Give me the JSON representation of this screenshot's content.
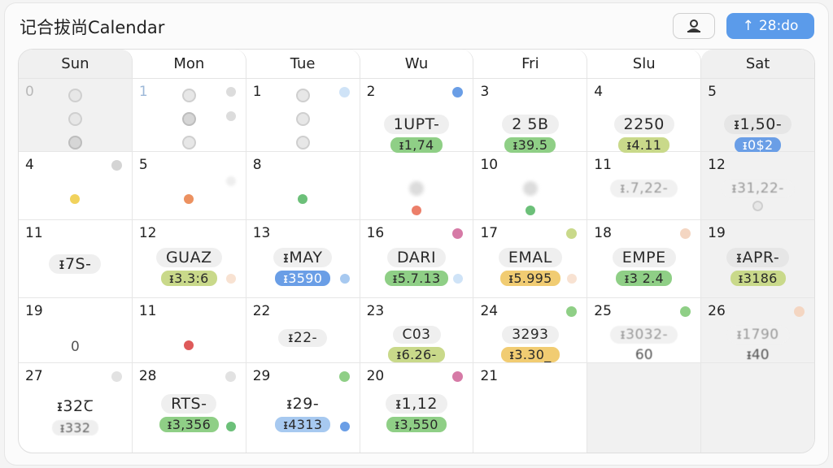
{
  "app": {
    "title": "记合拔尚Calendar"
  },
  "toolbar": {
    "profile_icon": "profile-icon",
    "primary_label": "28:do",
    "primary_icon": "arrow-up-icon"
  },
  "weekdays": [
    "Sun",
    "Mon",
    "Tue",
    "Wu",
    "Fri",
    "Slu",
    "Sat"
  ],
  "colors": {
    "green": "#8fcf86",
    "olive": "#c9d98a",
    "blue": "#6a9ee6",
    "light_blue": "#a7c9f0",
    "yellow": "#f1cc72",
    "red": "#de6a6a",
    "orange": "#ec9160",
    "pink": "#d67aa6",
    "gray": "#cfcfcf",
    "peach": "#f4d6c2"
  },
  "week0": {
    "sun": {
      "day": "0"
    },
    "mon": {
      "day": "1"
    },
    "tue": {
      "day": "1"
    },
    "wed": {
      "day": "2",
      "title": "1UPT-",
      "tag": "ᵻ1,74"
    },
    "fri": {
      "day": "3",
      "title": "2 5B",
      "tag": "ᵻ39.5"
    },
    "slu": {
      "day": "4",
      "title": "2250",
      "tag": "ᵻ4.11"
    },
    "sat": {
      "day": "5",
      "title": "ᵻ1,50-",
      "tag": "ᵻ0$2"
    }
  },
  "week1": {
    "sun": {
      "day": "4"
    },
    "mon": {
      "day": "5"
    },
    "tue": {
      "day": "8"
    },
    "wed": {
      "day": ""
    },
    "fri": {
      "day": "10"
    },
    "slu": {
      "day": "11",
      "title": "ᵻ.7,22-"
    },
    "sat": {
      "day": "12",
      "title": "ᵻ31,22-"
    }
  },
  "week2": {
    "sun": {
      "day": "11",
      "title": "ᵻ7S-"
    },
    "mon": {
      "day": "12",
      "title": "GUAZ",
      "tag": "ᵻ3.3:6"
    },
    "tue": {
      "day": "13",
      "title": "ᵻMAY",
      "tag": "ᵻ3590"
    },
    "wed": {
      "day": "16",
      "title": "DARI",
      "tag": "ᵻ5.7.13"
    },
    "fri": {
      "day": "17",
      "title": "EMAL",
      "tag": "ᵻ5.995"
    },
    "slu": {
      "day": "18",
      "title": "EMPE",
      "tag": "ᵻ3 2.4"
    },
    "sat": {
      "day": "19",
      "title": "ᵻAPR-",
      "tag": "ᵻ3186"
    }
  },
  "week3": {
    "sun": {
      "day": "19",
      "sub": "0"
    },
    "mon": {
      "day": "11"
    },
    "tue": {
      "day": "22",
      "title": "ᵻ22-"
    },
    "wed": {
      "day": "23",
      "title": "C03",
      "tag": "ᵻ6.26-"
    },
    "fri": {
      "day": "24",
      "title": "3293",
      "tag": "ᵻ3.30_"
    },
    "slu": {
      "day": "25",
      "title": "ᵻ3032-",
      "sub": "60"
    },
    "sat": {
      "day": "26",
      "title": "ᵻ1790",
      "sub": "ᵻ40"
    }
  },
  "week4": {
    "sun": {
      "day": "27",
      "title": "ᵻ32Ꞇ",
      "tag": "ᵻ332"
    },
    "mon": {
      "day": "28",
      "title": "RTS-",
      "tag": "ᵻ3,356"
    },
    "tue": {
      "day": "29",
      "title": "ᵻ29-",
      "tag": "ᵻ4313"
    },
    "wed": {
      "day": "20",
      "title": "ᵻ1,12",
      "tag": "ᵻ3,550"
    },
    "fri": {
      "day": "21"
    }
  }
}
